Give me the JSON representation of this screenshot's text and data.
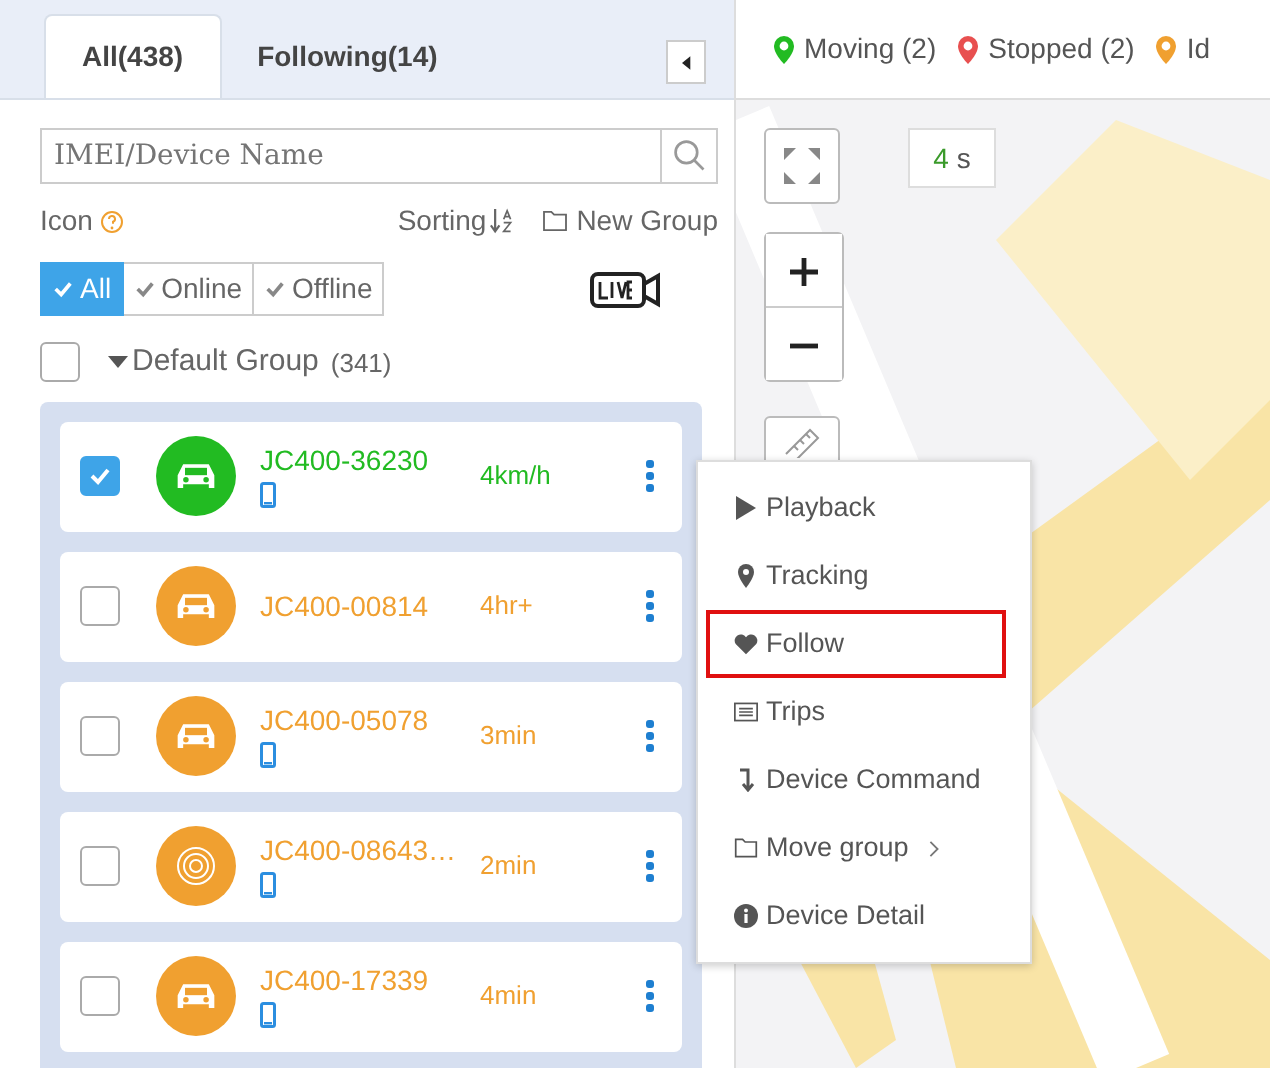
{
  "tabs": [
    {
      "label": "All(438)",
      "selected": true
    },
    {
      "label": "Following(14)",
      "selected": false
    }
  ],
  "search": {
    "placeholder": "IMEI/Device Name"
  },
  "options": {
    "icon_label": "Icon",
    "sorting_label": "Sorting",
    "new_group": "New Group"
  },
  "filters": [
    {
      "label": "All",
      "selected": true
    },
    {
      "label": "Online",
      "selected": false
    },
    {
      "label": "Offline",
      "selected": false
    }
  ],
  "group": {
    "name": "Default Group",
    "count": "(341)",
    "checked": false,
    "expanded": true
  },
  "devices": [
    {
      "name": "JC400-36230",
      "time": "4km/h",
      "color": "#22bb22",
      "kind": "car",
      "phone": true,
      "checked": true
    },
    {
      "name": "JC400-00814",
      "time": "4hr+",
      "color": "#f0a030",
      "kind": "car",
      "phone": false,
      "checked": false
    },
    {
      "name": "JC400-05078",
      "time": "3min",
      "color": "#f0a030",
      "kind": "car",
      "phone": true,
      "checked": false
    },
    {
      "name": "JC400-08643…",
      "time": "2min",
      "color": "#f0a030",
      "kind": "signal",
      "phone": true,
      "checked": false
    },
    {
      "name": "JC400-17339",
      "time": "4min",
      "color": "#f0a030",
      "kind": "car",
      "phone": true,
      "checked": false
    }
  ],
  "legend": [
    {
      "label": "Moving (2)",
      "color": "#22bb22"
    },
    {
      "label": "Stopped (2)",
      "color": "#e85050"
    },
    {
      "label": "Id",
      "color": "#f0a030"
    }
  ],
  "refresh": {
    "value": "4",
    "unit": "s"
  },
  "menu": [
    {
      "label": "Playback",
      "kind": "play",
      "highlighted": false
    },
    {
      "label": "Tracking",
      "kind": "pin",
      "highlighted": false
    },
    {
      "label": "Follow",
      "kind": "heart",
      "highlighted": true
    },
    {
      "label": "Trips",
      "kind": "list",
      "highlighted": false
    },
    {
      "label": "Device Command",
      "kind": "command",
      "highlighted": false
    },
    {
      "label": "Move group",
      "kind": "folder",
      "highlighted": false,
      "submenu": true
    },
    {
      "label": "Device Detail",
      "kind": "info",
      "highlighted": false
    }
  ]
}
